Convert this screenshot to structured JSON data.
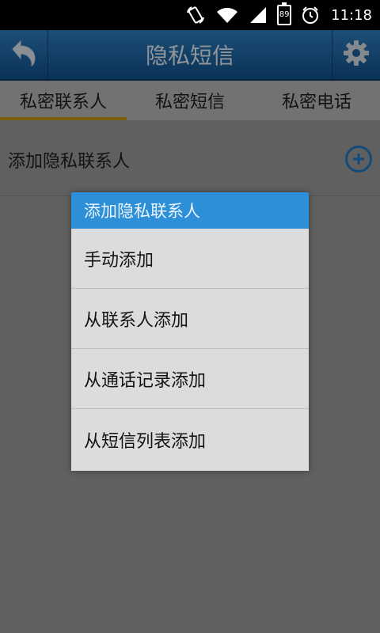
{
  "status_bar": {
    "time": "11:18",
    "battery_level": "89",
    "icons": [
      "rotate-icon",
      "wifi-icon",
      "signal-icon",
      "battery-icon",
      "alarm-icon"
    ]
  },
  "header": {
    "title": "隐私短信",
    "back_icon": "back-arrow-icon",
    "settings_icon": "gear-icon"
  },
  "tabs": [
    {
      "label": "私密联系人",
      "active": true
    },
    {
      "label": "私密短信",
      "active": false
    },
    {
      "label": "私密电话",
      "active": false
    }
  ],
  "main": {
    "add_contact_label": "添加隐私联系人",
    "add_icon": "plus-circle-icon"
  },
  "dialog": {
    "title": "添加隐私联系人",
    "items": [
      {
        "label": "手动添加"
      },
      {
        "label": "从联系人添加"
      },
      {
        "label": "从通话记录添加"
      },
      {
        "label": "从短信列表添加"
      }
    ]
  },
  "colors": {
    "accent": "#2d8fd7",
    "title_bar": "#1a5f9e",
    "tab_indicator": "#c99a12"
  }
}
